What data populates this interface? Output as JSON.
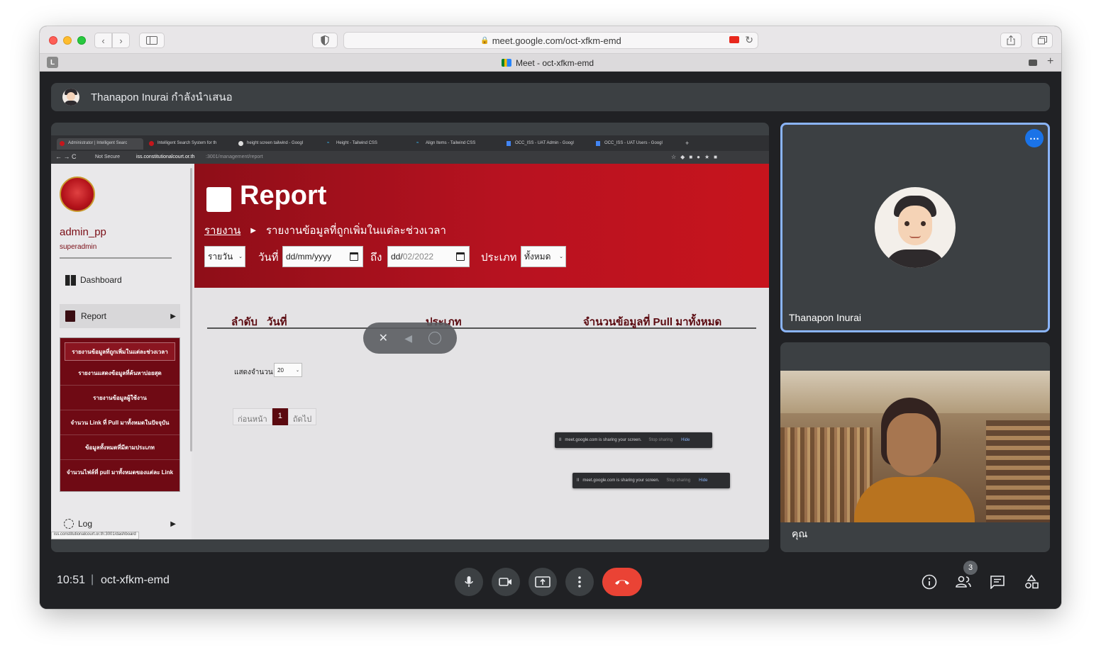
{
  "browser": {
    "url": "meet.google.com/oct-xfkm-emd",
    "tab_title": "Meet - oct-xfkm-emd",
    "profile_letter": "L"
  },
  "meet": {
    "presenter_banner": "Thanapon Inurai กำลังนำเสนอ",
    "time": "10:51",
    "separator": "|",
    "meeting_code": "oct-xfkm-emd",
    "participants_count": "3",
    "accent_red": "#ea4335",
    "accent_blue": "#8ab4f8"
  },
  "tiles": {
    "presenter_name": "Thanapon Inurai",
    "self_name": "คุณ"
  },
  "shared_screen": {
    "tabs": [
      "Administrator | Intelligent Searc",
      "Intelligent Search System for th",
      "height screen tailwind - Googl",
      "Height - Tailwind CSS",
      "Align Items - Tailwind CSS",
      "OCC_ISS - UAT Admin - Googl",
      "OCC_ISS - UAT Users - Googl"
    ],
    "not_secure": "Not Secure",
    "inner_url": "iss.constitutionalcourt.or.th",
    "inner_url_path": ":3001/management/report",
    "status_url": "iss.constitutionalcourt.or.th:3001/dashboard",
    "user": {
      "name": "admin_pp",
      "role": "superadmin"
    },
    "menu": {
      "dashboard": "Dashboard",
      "report": "Report",
      "log": "Log",
      "report_submenu": [
        "รายงานข้อมูลที่ถูกเพิ่มในแต่ละช่วงเวลา",
        "รายงานแสดงข้อมูลที่ค้นหาบ่อยสุด",
        "รายงานข้อมูลผู้ใช้งาน",
        "จำนวน Link ที่ Pull มาทั้งหมดในปัจจุบัน",
        "ข้อมูลทั้งหมดที่มีตามประเภท",
        "จำนวนไฟล์ที่ pull มาทั้งหมดของแต่ละ Link"
      ]
    },
    "page_title": "Report",
    "breadcrumb_link": "รายงาน",
    "breadcrumb_current": "รายงานข้อมูลที่ถูกเพิ่มในแต่ละช่วงเวลา",
    "filters": {
      "period": "รายวัน",
      "date_label": "วันที่",
      "date_from": "dd/mm/yyyy",
      "to_label": "ถึง",
      "date_to_prefix": "dd/",
      "date_to": "02/2022",
      "type_label": "ประเภท",
      "type_value": "ทั้งหมด"
    },
    "table_headers": [
      "ลำดับ",
      "วันที่",
      "ประเภท",
      "จำนวนข้อมูลที่ Pull มาทั้งหมด"
    ],
    "page_size_label": "แสดงจำนวน",
    "page_size": "20",
    "pagination": {
      "prev": "ก่อนหน้า",
      "current": "1",
      "next": "ถัดไป"
    },
    "share_notice": {
      "text": "meet.google.com is sharing your screen.",
      "stop": "Stop sharing",
      "hide": "Hide"
    },
    "theme_red": "#b81220"
  }
}
